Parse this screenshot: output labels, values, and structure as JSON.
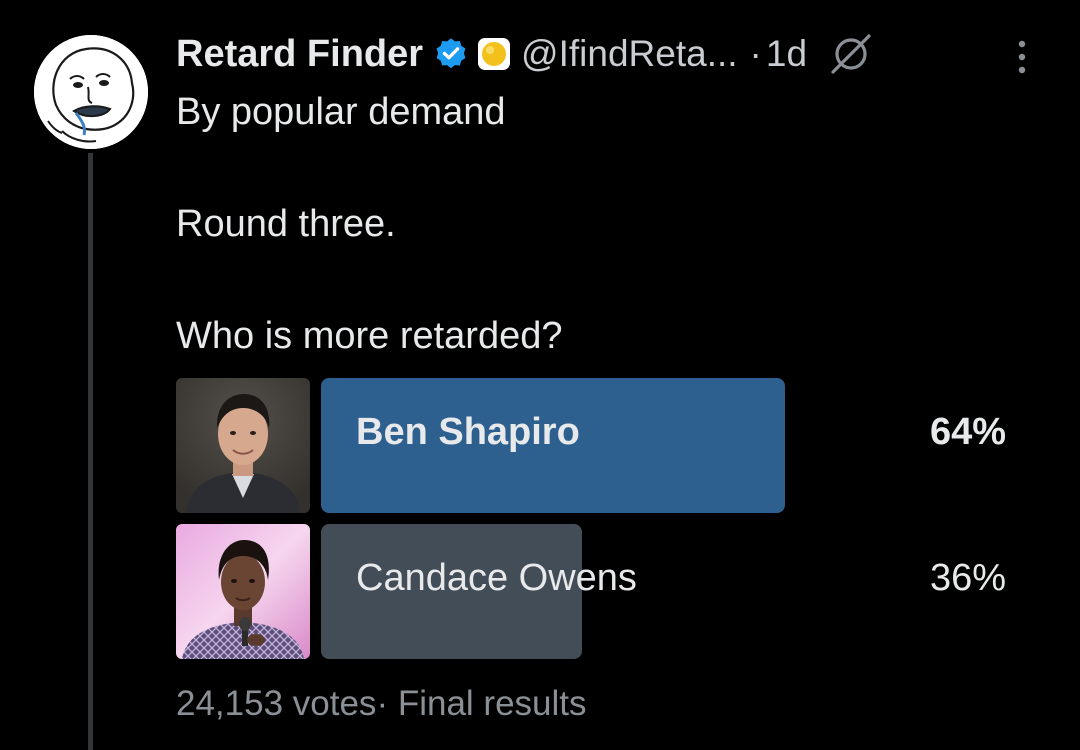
{
  "tweet": {
    "display_name": "Retard Finder",
    "handle": "@IfindReta...",
    "separator": "·",
    "time": "1d",
    "avatar_icon": "wojak-face-avatar",
    "verified_icon": "verified-badge-icon",
    "emoji_icon": "yellow-circle-emoji-icon",
    "grok_icon": "grok-icon",
    "more_icon": "more-options-icon",
    "text_lines": [
      "By popular demand",
      "Round three.",
      "Who is more retarded?"
    ]
  },
  "poll": {
    "options": [
      {
        "label": "Ben Shapiro",
        "percent_label": "64%",
        "percent": 64,
        "winner": true,
        "image": "ben-shapiro-photo"
      },
      {
        "label": "Candace Owens",
        "percent_label": "36%",
        "percent": 36,
        "winner": false,
        "image": "candace-owens-photo"
      }
    ],
    "votes": "24,153 votes",
    "status_separator": "·",
    "status": "Final results"
  },
  "colors": {
    "background": "#000000",
    "winner_bar": "#2d5f8f",
    "loser_bar": "#434d57",
    "verified": "#1d9bf0",
    "secondary_text": "#8b9096",
    "thread_line": "#333639"
  }
}
